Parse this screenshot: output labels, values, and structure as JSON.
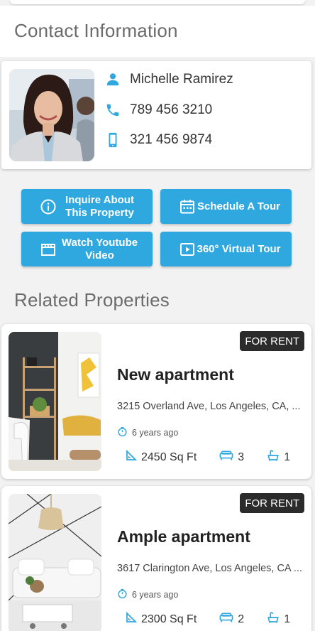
{
  "contact": {
    "section_title": "Contact Information",
    "name": "Michelle Ramirez",
    "phone": "789 456 3210",
    "mobile": "321 456 9874"
  },
  "actions": {
    "inquire": "Inquire About This Property",
    "schedule": "Schedule A Tour",
    "youtube": "Watch Youtube Video",
    "virtual": "360° Virtual Tour"
  },
  "related": {
    "section_title": "Related Properties",
    "items": [
      {
        "badge": "FOR RENT",
        "title": "New apartment",
        "address": "3215 Overland Ave, Los Angeles, CA, ...",
        "age": "6 years ago",
        "area": "2450 Sq Ft",
        "beds": "3",
        "baths": "1"
      },
      {
        "badge": "FOR RENT",
        "title": "Ample apartment",
        "address": "3617 Clarington Ave, Los Angeles, CA ...",
        "age": "6 years ago",
        "area": "2300 Sq Ft",
        "beds": "2",
        "baths": "1"
      }
    ]
  },
  "colors": {
    "accent": "#2fa8df",
    "badge_bg": "#2b2b2b"
  },
  "icons": [
    "person-icon",
    "phone-icon",
    "mobile-icon",
    "info-icon",
    "calendar-icon",
    "video-icon",
    "play-icon",
    "clock-icon",
    "area-icon",
    "bed-icon",
    "bath-icon"
  ]
}
